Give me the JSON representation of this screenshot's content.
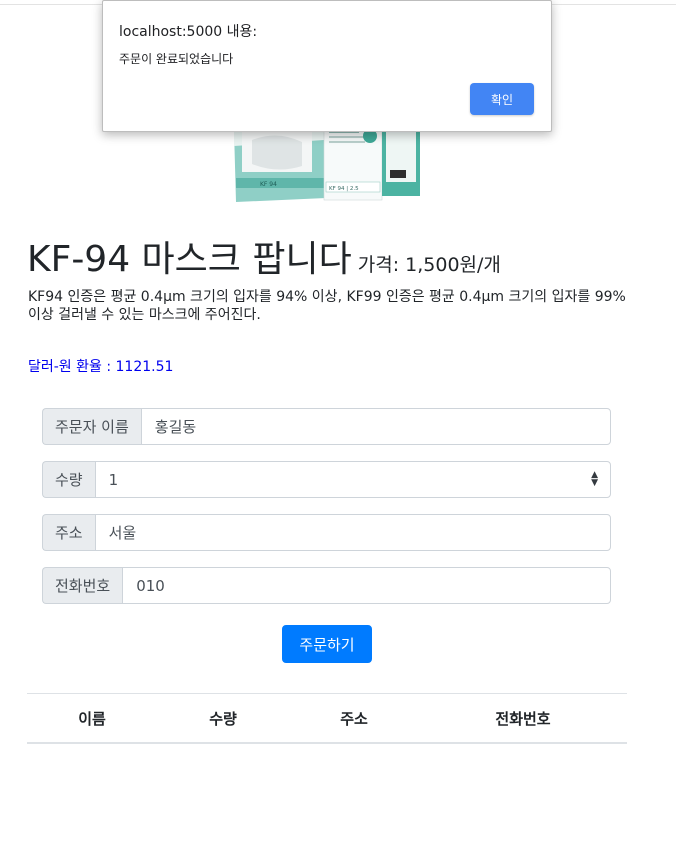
{
  "dialog": {
    "title": "localhost:5000 내용:",
    "message": "주문이 완료되었습니다",
    "ok_label": "확인",
    "ok_color": "#4285f4"
  },
  "product": {
    "image_icon": "mask-package-image",
    "name": "KF-94 마스크 팝니다",
    "price": "가격: 1,500원/개",
    "description": "KF94 인증은 평균 0.4μm 크기의 입자를 94% 이상, KF99 인증은 평균 0.4μm 크기의 입자를 99% 이상 걸러낼 수 있는 마스크에 주어진다.",
    "exchange_rate": "달러-원 환율 : 1121.51"
  },
  "form": {
    "name_label": "주문자 이름",
    "name_value": "홍길동",
    "qty_label": "수량",
    "qty_value": "1",
    "address_label": "주소",
    "address_value": "서울",
    "phone_label": "전화번호",
    "phone_value": "010",
    "submit_label": "주문하기"
  },
  "table": {
    "headers": [
      "이름",
      "수량",
      "주소",
      "전화번호"
    ]
  },
  "colors": {
    "primary": "#007bff",
    "rate_link": "#0000ee",
    "addon_bg": "#e9ecef"
  }
}
